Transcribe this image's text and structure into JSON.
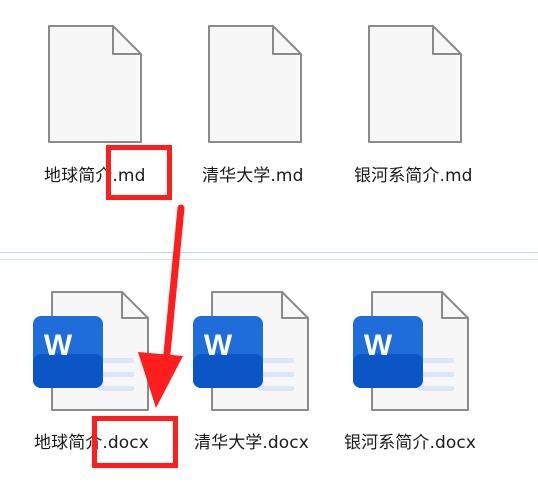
{
  "top_files": [
    {
      "name": "地球简介.md",
      "icon": "document-icon"
    },
    {
      "name": "清华大学.md",
      "icon": "document-icon"
    },
    {
      "name": "银河系简介.md",
      "icon": "document-icon"
    }
  ],
  "bottom_files": [
    {
      "name": "地球简介.docx",
      "icon": "word-document-icon",
      "badge": "W"
    },
    {
      "name": "清华大学.docx",
      "icon": "word-document-icon",
      "badge": "W"
    },
    {
      "name": "银河系简介.docx",
      "icon": "word-document-icon",
      "badge": "W"
    }
  ],
  "colors": {
    "highlight": "#ff1e1e",
    "arrow": "#ff1e1e",
    "word_blue": "#1e6ddb",
    "word_blue_dark": "#0b55c6",
    "doc_fill": "#f7f7f7",
    "doc_stroke": "#8a8a8a"
  }
}
